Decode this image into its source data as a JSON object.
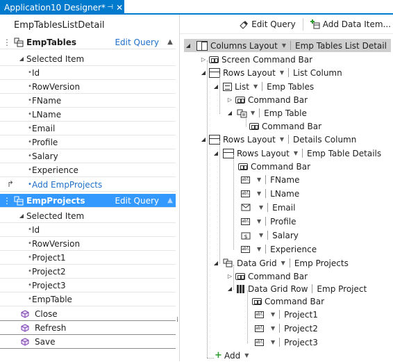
{
  "tab": {
    "title": "Application10 Designer*",
    "pin": "⊣",
    "close": "✕"
  },
  "left": {
    "title": "EmpTablesListDetail",
    "entities": [
      {
        "name": "EmpTables",
        "edit_label": "Edit Query",
        "selected_item": "Selected Item",
        "fields": [
          "Id",
          "RowVersion",
          "FName",
          "LName",
          "Email",
          "Profile",
          "Salary",
          "Experience"
        ],
        "add_label": "Add EmpProjects"
      },
      {
        "name": "EmpProjects",
        "edit_label": "Edit Query",
        "selected_item": "Selected Item",
        "fields": [
          "Id",
          "RowVersion",
          "Project1",
          "Project2",
          "Project3",
          "EmpTable"
        ]
      }
    ],
    "commands": [
      "Close",
      "Refresh",
      "Save"
    ]
  },
  "toolbar": {
    "edit_query": "Edit Query",
    "add_data_item": "Add Data Item..."
  },
  "tree": {
    "root": {
      "type": "Columns Layout",
      "name": "Emp Tables List Detail"
    },
    "screen_command_bar": "Screen Command Bar",
    "list_column": {
      "type": "Rows Layout",
      "name": "List Column"
    },
    "list": {
      "type": "List",
      "name": "Emp Tables"
    },
    "list_command_bar": "Command Bar",
    "emp_table": "Emp Table",
    "emp_table_command_bar": "Command Bar",
    "details_column": {
      "type": "Rows Layout",
      "name": "Details Column"
    },
    "details": {
      "type": "Rows Layout",
      "name": "Emp Table Details"
    },
    "details_command_bar": "Command Bar",
    "detail_fields": [
      "FName",
      "LName",
      "Email",
      "Profile",
      "Salary",
      "Experience"
    ],
    "data_grid": {
      "type": "Data Grid",
      "name": "Emp Projects"
    },
    "grid_command_bar": "Command Bar",
    "grid_row": {
      "type": "Data Grid Row",
      "name": "Emp Project"
    },
    "row_command_bar": "Command Bar",
    "row_fields": [
      "Project1",
      "Project2",
      "Project3"
    ],
    "add_label": "Add"
  },
  "colors": {
    "accent": "#007acc",
    "selection": "#3399ff",
    "link": "#1e6fc9"
  }
}
